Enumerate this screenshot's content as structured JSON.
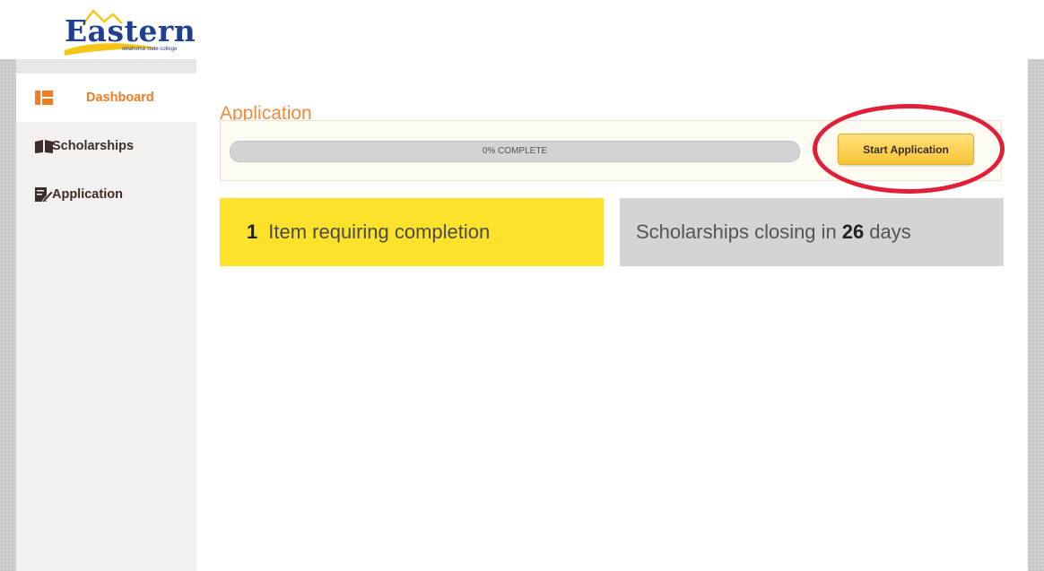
{
  "header": {
    "logo": {
      "name": "Eastern",
      "subtitle": "oklahoma state college",
      "brand_color": "#1f3f93",
      "accent_color": "#f5c518"
    }
  },
  "sidebar": {
    "items": [
      {
        "label": "Dashboard",
        "icon": "dashboard-icon",
        "active": true
      },
      {
        "label": "Scholarships",
        "icon": "book-icon",
        "active": false
      },
      {
        "label": "Application",
        "icon": "edit-icon",
        "active": false
      }
    ]
  },
  "main": {
    "title": "Application",
    "progress": {
      "percent": 0,
      "label": "0% COMPLETE"
    },
    "start_button": {
      "label": "Start Application"
    },
    "items_tile": {
      "count": "1",
      "text": "Item requiring completion"
    },
    "closing_tile": {
      "prefix": "Scholarships closing in",
      "days": "26",
      "suffix": "days"
    }
  },
  "colors": {
    "active_nav": "#f07c23",
    "title": "#f08a3c",
    "yellow_tile": "#fde22c",
    "grey_tile": "#d4d4d4",
    "annotation_circle": "#e0203a"
  }
}
